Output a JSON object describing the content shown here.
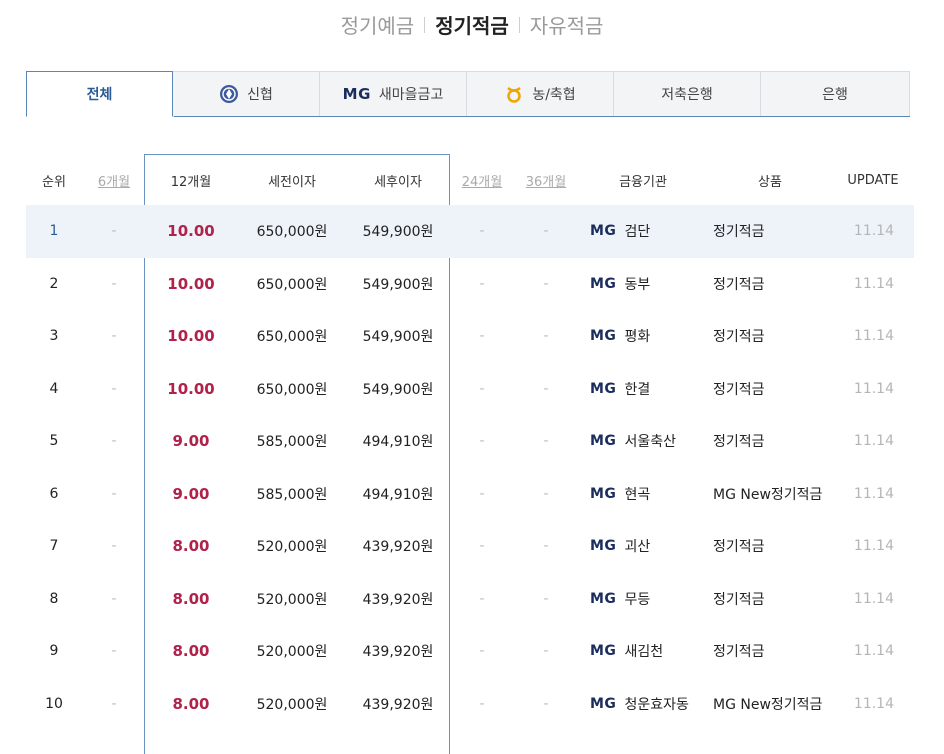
{
  "top_tabs": [
    {
      "label": "정기예금",
      "active": false
    },
    {
      "label": "정기적금",
      "active": true
    },
    {
      "label": "자유적금",
      "active": false
    }
  ],
  "inst_tabs": [
    {
      "label": "전체",
      "icon": "",
      "active": true
    },
    {
      "label": "신협",
      "icon": "shinhyup-logo-icon",
      "active": false
    },
    {
      "label": "새마을금고",
      "icon": "mg-logo-icon",
      "icon_text": "MG",
      "active": false
    },
    {
      "label": "농/축협",
      "icon": "nh-logo-icon",
      "active": false
    },
    {
      "label": "저축은행",
      "icon": "",
      "active": false
    },
    {
      "label": "은행",
      "icon": "",
      "active": false
    }
  ],
  "table": {
    "headers": {
      "rank": "순위",
      "m6": "6개월",
      "m12": "12개월",
      "pre_tax": "세전이자",
      "post_tax": "세후이자",
      "m24": "24개월",
      "m36": "36개월",
      "institution": "금융기관",
      "product": "상품",
      "update": "UPDATE"
    },
    "mg_text": "MG",
    "rows": [
      {
        "rank": "1",
        "m6": "-",
        "rate": "10.00",
        "pre": "650,000원",
        "post": "549,900원",
        "m24": "-",
        "m36": "-",
        "inst": "검단",
        "product": "정기적금",
        "update": "11.14"
      },
      {
        "rank": "2",
        "m6": "-",
        "rate": "10.00",
        "pre": "650,000원",
        "post": "549,900원",
        "m24": "-",
        "m36": "-",
        "inst": "동부",
        "product": "정기적금",
        "update": "11.14"
      },
      {
        "rank": "3",
        "m6": "-",
        "rate": "10.00",
        "pre": "650,000원",
        "post": "549,900원",
        "m24": "-",
        "m36": "-",
        "inst": "평화",
        "product": "정기적금",
        "update": "11.14"
      },
      {
        "rank": "4",
        "m6": "-",
        "rate": "10.00",
        "pre": "650,000원",
        "post": "549,900원",
        "m24": "-",
        "m36": "-",
        "inst": "한결",
        "product": "정기적금",
        "update": "11.14"
      },
      {
        "rank": "5",
        "m6": "-",
        "rate": "9.00",
        "pre": "585,000원",
        "post": "494,910원",
        "m24": "-",
        "m36": "-",
        "inst": "서울축산",
        "product": "정기적금",
        "update": "11.14"
      },
      {
        "rank": "6",
        "m6": "-",
        "rate": "9.00",
        "pre": "585,000원",
        "post": "494,910원",
        "m24": "-",
        "m36": "-",
        "inst": "현곡",
        "product": "MG New정기적금",
        "update": "11.14"
      },
      {
        "rank": "7",
        "m6": "-",
        "rate": "8.00",
        "pre": "520,000원",
        "post": "439,920원",
        "m24": "-",
        "m36": "-",
        "inst": "괴산",
        "product": "정기적금",
        "update": "11.14"
      },
      {
        "rank": "8",
        "m6": "-",
        "rate": "8.00",
        "pre": "520,000원",
        "post": "439,920원",
        "m24": "-",
        "m36": "-",
        "inst": "무등",
        "product": "정기적금",
        "update": "11.14"
      },
      {
        "rank": "9",
        "m6": "-",
        "rate": "8.00",
        "pre": "520,000원",
        "post": "439,920원",
        "m24": "-",
        "m36": "-",
        "inst": "새김천",
        "product": "정기적금",
        "update": "11.14"
      },
      {
        "rank": "10",
        "m6": "-",
        "rate": "8.00",
        "pre": "520,000원",
        "post": "439,920원",
        "m24": "-",
        "m36": "-",
        "inst": "청운효자동",
        "product": "MG New정기적금",
        "update": "11.14"
      }
    ]
  },
  "colors": {
    "accent": "#5a86b8",
    "rate": "#b0224a",
    "mg": "#1b2d5c",
    "highlight": "#eef3fa"
  }
}
